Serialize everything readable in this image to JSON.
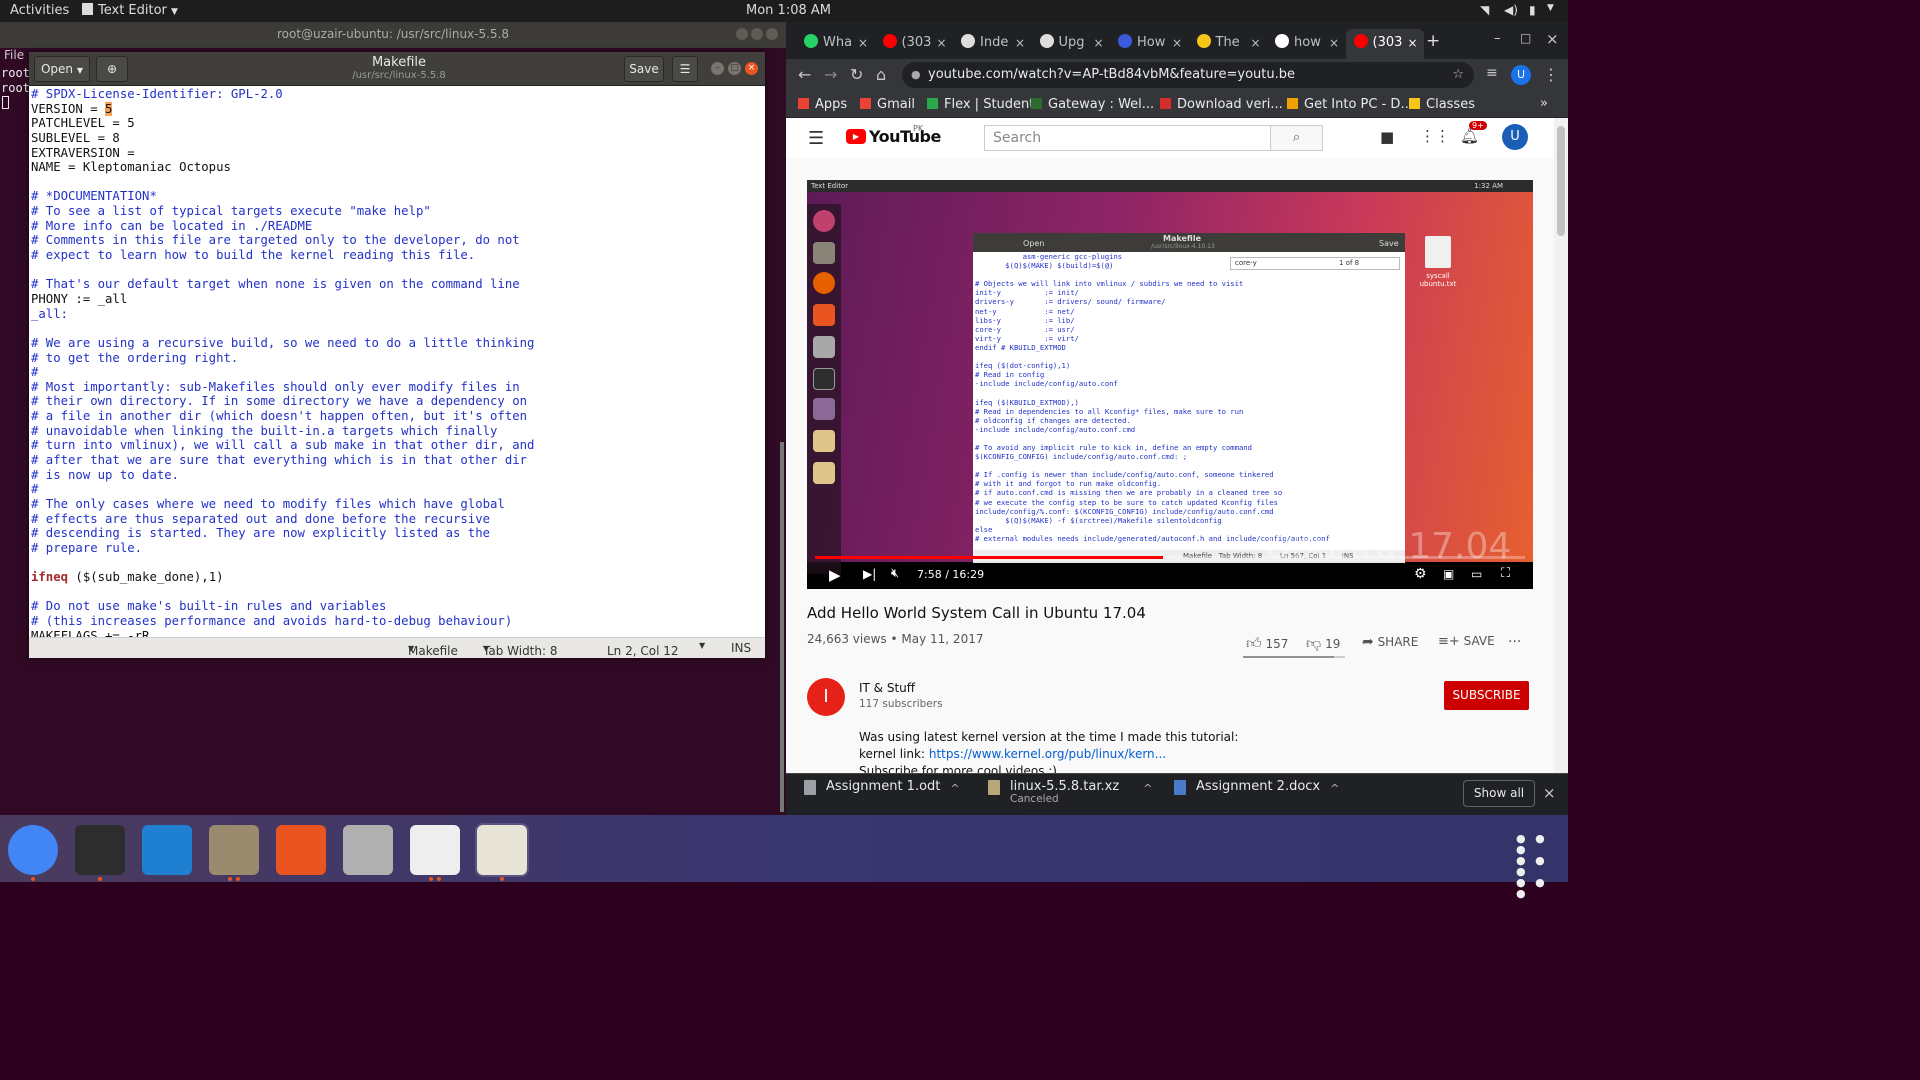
{
  "topbar": {
    "activities": "Activities",
    "app_menu": "Text Editor",
    "clock": "Mon  1:08 AM"
  },
  "terminal": {
    "title": "root@uzair-ubuntu: /usr/src/linux-5.5.8",
    "menu_file": "File",
    "line1": "root",
    "line2": "root"
  },
  "gedit": {
    "open_label": "Open",
    "title": "Makefile",
    "subtitle": "/usr/src/linux-5.5.8",
    "save_label": "Save",
    "status": {
      "language": "Makefile",
      "tab_width": "Tab Width: 8",
      "position": "Ln 2, Col 12",
      "mode": "INS"
    },
    "lines": [
      {
        "t": "# SPDX-License-Identifier: GPL-2.0",
        "c": "cm"
      },
      {
        "t": "VERSION = ",
        "hl": "5",
        "c": ""
      },
      {
        "t": "PATCHLEVEL = 5",
        "c": ""
      },
      {
        "t": "SUBLEVEL = 8",
        "c": ""
      },
      {
        "t": "EXTRAVERSION =",
        "c": ""
      },
      {
        "t": "NAME = Kleptomaniac Octopus",
        "c": ""
      },
      {
        "t": "",
        "c": ""
      },
      {
        "t": "# *DOCUMENTATION*",
        "c": "cm"
      },
      {
        "t": "# To see a list of typical targets execute \"make help\"",
        "c": "cm"
      },
      {
        "t": "# More info can be located in ./README",
        "c": "cm"
      },
      {
        "t": "# Comments in this file are targeted only to the developer, do not",
        "c": "cm"
      },
      {
        "t": "# expect to learn how to build the kernel reading this file.",
        "c": "cm"
      },
      {
        "t": "",
        "c": ""
      },
      {
        "t": "# That's our default target when none is given on the command line",
        "c": "cm"
      },
      {
        "t": "PHONY := _all",
        "c": ""
      },
      {
        "t": "_all:",
        "c": "cm"
      },
      {
        "t": "",
        "c": ""
      },
      {
        "t": "# We are using a recursive build, so we need to do a little thinking",
        "c": "cm"
      },
      {
        "t": "# to get the ordering right.",
        "c": "cm"
      },
      {
        "t": "#",
        "c": "cm"
      },
      {
        "t": "# Most importantly: sub-Makefiles should only ever modify files in",
        "c": "cm"
      },
      {
        "t": "# their own directory. If in some directory we have a dependency on",
        "c": "cm"
      },
      {
        "t": "# a file in another dir (which doesn't happen often, but it's often",
        "c": "cm"
      },
      {
        "t": "# unavoidable when linking the built-in.a targets which finally",
        "c": "cm"
      },
      {
        "t": "# turn into vmlinux), we will call a sub make in that other dir, and",
        "c": "cm"
      },
      {
        "t": "# after that we are sure that everything which is in that other dir",
        "c": "cm"
      },
      {
        "t": "# is now up to date.",
        "c": "cm"
      },
      {
        "t": "#",
        "c": "cm"
      },
      {
        "t": "# The only cases where we need to modify files which have global",
        "c": "cm"
      },
      {
        "t": "# effects are thus separated out and done before the recursive",
        "c": "cm"
      },
      {
        "t": "# descending is started. They are now explicitly listed as the",
        "c": "cm"
      },
      {
        "t": "# prepare rule.",
        "c": "cm"
      },
      {
        "t": "",
        "c": ""
      },
      {
        "t": "ifneq",
        "rest": " ($(sub_make_done),1)",
        "c": "kw"
      },
      {
        "t": "",
        "c": ""
      },
      {
        "t": "# Do not use make's built-in rules and variables",
        "c": "cm"
      },
      {
        "t": "# (this increases performance and avoids hard-to-debug behaviour)",
        "c": "cm"
      },
      {
        "t": "MAKEFLAGS += -rR",
        "c": ""
      }
    ]
  },
  "chrome": {
    "tabs": [
      {
        "label": "Wha",
        "color": "#25d366"
      },
      {
        "label": "(303",
        "color": "#ff0000"
      },
      {
        "label": "Inde",
        "color": "#dddddd"
      },
      {
        "label": "Upg",
        "color": "#dddddd"
      },
      {
        "label": "How",
        "color": "#3b5bdb"
      },
      {
        "label": "The",
        "color": "#f5c518"
      },
      {
        "label": "how",
        "color": "#ffffff"
      },
      {
        "label": "(303",
        "color": "#ff0000"
      }
    ],
    "url": "youtube.com/watch?v=AP-tBd84vbM&feature=youtu.be",
    "profile_initial": "U",
    "bookmarks": [
      {
        "label": "Apps",
        "color": "#e94235"
      },
      {
        "label": "Gmail",
        "color": "#ea4335"
      },
      {
        "label": "Flex | Student",
        "color": "#2aa84a"
      },
      {
        "label": "Gateway : Wel...",
        "color": "#2d6a2d"
      },
      {
        "label": "Download veri...",
        "color": "#d42b2b"
      },
      {
        "label": "Get Into PC - D...",
        "color": "#f0a000"
      },
      {
        "label": "Classes",
        "color": "#f5c518"
      }
    ]
  },
  "youtube": {
    "logo_text": "YouTube",
    "logo_region": "PK",
    "search_placeholder": "Search",
    "notif_count": "9+",
    "avatar_initial": "U",
    "video": {
      "inner_app": "Text Editor",
      "inner_clock": "1:32 AM",
      "inner_title": "Makefile",
      "inner_path": "/usr/src/linux-4.10.13",
      "inner_open": "Open",
      "inner_save": "Save",
      "inner_search": "core-y",
      "inner_match": "1 of 8",
      "inner_status": "Makefile   Tab Width: 8        Ln 567, Col 1       INS",
      "desktop_file": "syscall ubuntu.txt",
      "watermark": "Ubuntu 17.04",
      "time": "7:58 / 16:29",
      "progress": 0.49,
      "code": "           asm-generic gcc-plugins\n       $(Q)$(MAKE) $(build)=$(@)\n\n# Objects we will link into vmlinux / subdirs we need to visit\ninit-y          := init/\ndrivers-y       := drivers/ sound/ firmware/\nnet-y           := net/\nlibs-y          := lib/\ncore-y          := usr/\nvirt-y          := virt/\nendif # KBUILD_EXTMOD\n\nifeq ($(dot-config),1)\n# Read in config\n-include include/config/auto.conf\n\nifeq ($(KBUILD_EXTMOD),)\n# Read in dependencies to all Kconfig* files, make sure to run\n# oldconfig if changes are detected.\n-include include/config/auto.conf.cmd\n\n# To avoid any implicit rule to kick in, define an empty command\n$(KCONFIG_CONFIG) include/config/auto.conf.cmd: ;\n\n# If .config is newer than include/config/auto.conf, someone tinkered\n# with it and forgot to run make oldconfig.\n# if auto.conf.cmd is missing then we are probably in a cleaned tree so\n# we execute the config step to be sure to catch updated Kconfig files\ninclude/config/%.conf: $(KCONFIG_CONFIG) include/config/auto.conf.cmd\n       $(Q)$(MAKE) -f $(srctree)/Makefile silentoldconfig\nelse\n# external modules needs include/generated/autoconf.h and include/config/auto.conf"
    },
    "title": "Add Hello World System Call in Ubuntu 17.04",
    "views": "24,663 views",
    "date": "May 11, 2017",
    "likes": "157",
    "dislikes": "19",
    "share": "SHARE",
    "save": "SAVE",
    "channel_initial": "I",
    "channel_name": "IT & Stuff",
    "subscribers": "117 subscribers",
    "subscribe": "SUBSCRIBE",
    "desc1": "Was using latest kernel version at the time I made this tutorial:",
    "desc2_label": "kernel link:",
    "desc2_link": "https://www.kernel.org/pub/linux/kern...",
    "desc3": "Subscribe for more cool videos :)"
  },
  "downloads": [
    {
      "name": "Assignment 1.odt",
      "status": ""
    },
    {
      "name": "linux-5.5.8.tar.xz",
      "status": "Canceled"
    },
    {
      "name": "Assignment 2.docx",
      "status": ""
    }
  ],
  "downloads_show_all": "Show all",
  "dock": [
    {
      "name": "chrome-icon",
      "color": "#4285f4",
      "running": 1
    },
    {
      "name": "terminal-icon",
      "color": "#2d2d2d",
      "running": 1
    },
    {
      "name": "vscode-icon",
      "color": "#1f7fd0",
      "running": 0
    },
    {
      "name": "files-icon",
      "color": "#9a8a6e",
      "running": 2
    },
    {
      "name": "software-center-icon",
      "color": "#e95420",
      "running": 0
    },
    {
      "name": "settings-icon",
      "color": "#b0b0b0",
      "running": 0
    },
    {
      "name": "pdf-reader-icon",
      "color": "#eeeeee",
      "running": 2
    },
    {
      "name": "text-editor-icon",
      "color": "#e8e4d8",
      "running": 1
    }
  ]
}
